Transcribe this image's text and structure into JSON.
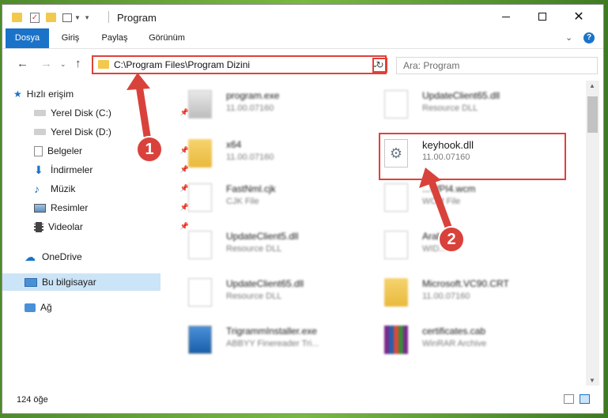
{
  "window": {
    "title": "Program"
  },
  "ribbon": {
    "tabs": [
      "Dosya",
      "Giriş",
      "Paylaş",
      "Görünüm"
    ]
  },
  "address": {
    "path": "C:\\Program Files\\Program Dizini"
  },
  "search": {
    "placeholder": "Ara: Program"
  },
  "sidebar": {
    "quick_access": "Hızlı erişim",
    "items": [
      "Yerel Disk (C:)",
      "Yerel Disk (D:)",
      "Belgeler",
      "İndirmeler",
      "Müzik",
      "Resimler",
      "Videolar"
    ],
    "onedrive": "OneDrive",
    "this_pc": "Bu bilgisayar",
    "network": "Ağ"
  },
  "files": [
    {
      "name": "program.exe",
      "sub": "11.00.07160"
    },
    {
      "name": "UpdateClient65.dll",
      "sub": "Resource DLL"
    },
    {
      "name": "x64",
      "sub": "11.00.07160"
    },
    {
      "name": "keyhook.dll",
      "sub": "11.00.07160"
    },
    {
      "name": "FastNml.cjk",
      "sub": "CJK File"
    },
    {
      "name": "...WPI4.wcm",
      "sub": "WCM File"
    },
    {
      "name": "UpdateClient5.dll",
      "sub": "Resource DLL"
    },
    {
      "name": "Arab...",
      "sub": "WID..."
    },
    {
      "name": "UpdateClient65.dll",
      "sub": "Resource DLL"
    },
    {
      "name": "Microsoft.VC90.CRT",
      "sub": "11.00.07160"
    },
    {
      "name": "TrigrammInstaller.exe",
      "sub": "ABBYY Finereader Tri..."
    },
    {
      "name": "certificates.cab",
      "sub": "WinRAR Archive"
    }
  ],
  "status": {
    "count": "124 öğe"
  },
  "annotations": [
    "1",
    "2"
  ],
  "colors": {
    "accent": "#1a73c8",
    "highlight": "#e0403a"
  }
}
